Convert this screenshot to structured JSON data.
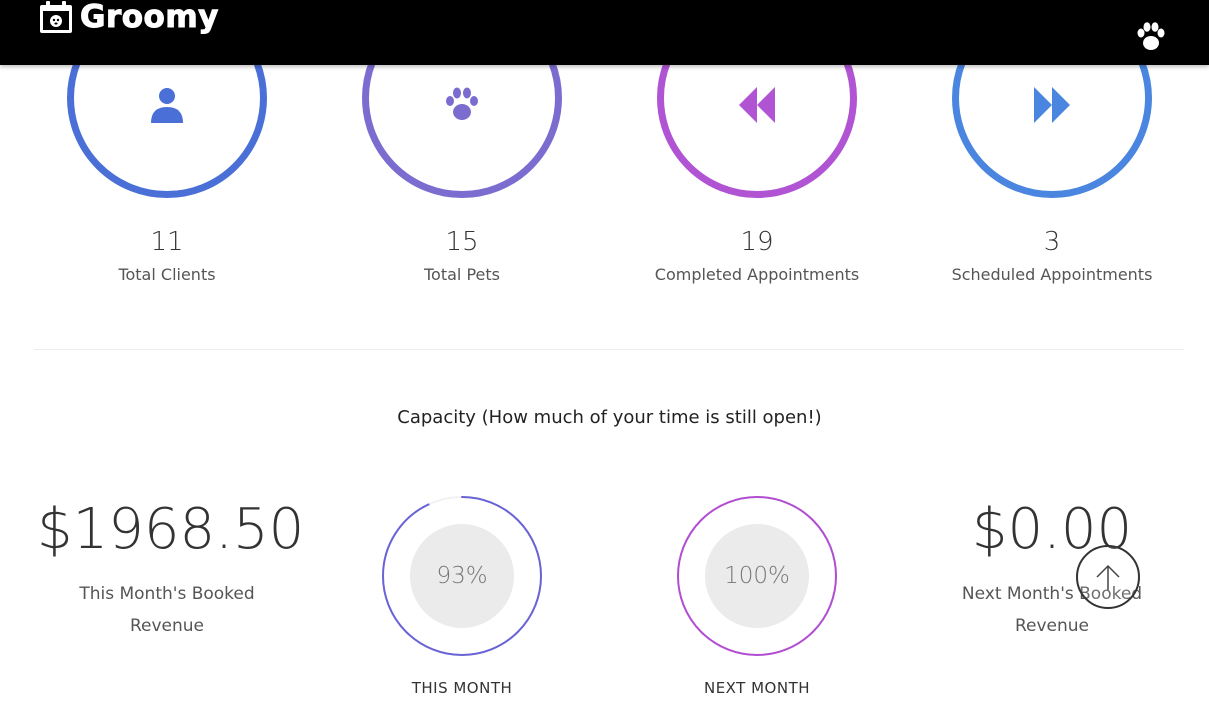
{
  "header": {
    "app_name": "Groomy",
    "logo_icon": "calendar-dog-icon",
    "menu_icon": "paw-icon"
  },
  "stats": [
    {
      "value": "11",
      "label": "Total Clients",
      "icon": "user-icon",
      "color": "#4a6fd6"
    },
    {
      "value": "15",
      "label": "Total Pets",
      "icon": "paw-icon",
      "color": "#7b6dd0"
    },
    {
      "value": "19",
      "label": "Completed Appointments",
      "icon": "rewind-icon",
      "color": "#b054d4"
    },
    {
      "value": "3",
      "label": "Scheduled Appointments",
      "icon": "fast-forward-icon",
      "color": "#4a86e0"
    }
  ],
  "capacity": {
    "title": "Capacity (How much of your time is still open!)",
    "this_month": {
      "percent_label": "93%",
      "fraction": 0.93,
      "caption": "THIS MONTH",
      "color": "#6a63d6"
    },
    "next_month": {
      "percent_label": "100%",
      "fraction": 1.0,
      "caption": "NEXT MONTH",
      "color": "#b24ed2"
    }
  },
  "revenue": {
    "this_month": {
      "amount": "$1968.50",
      "label_line1": "This Month's Booked",
      "label_line2": "Revenue"
    },
    "next_month": {
      "amount": "$0.00",
      "label_line1": "Next Month's Booked",
      "label_line2": "Revenue"
    }
  },
  "scroll_top_icon": "arrow-up-icon"
}
